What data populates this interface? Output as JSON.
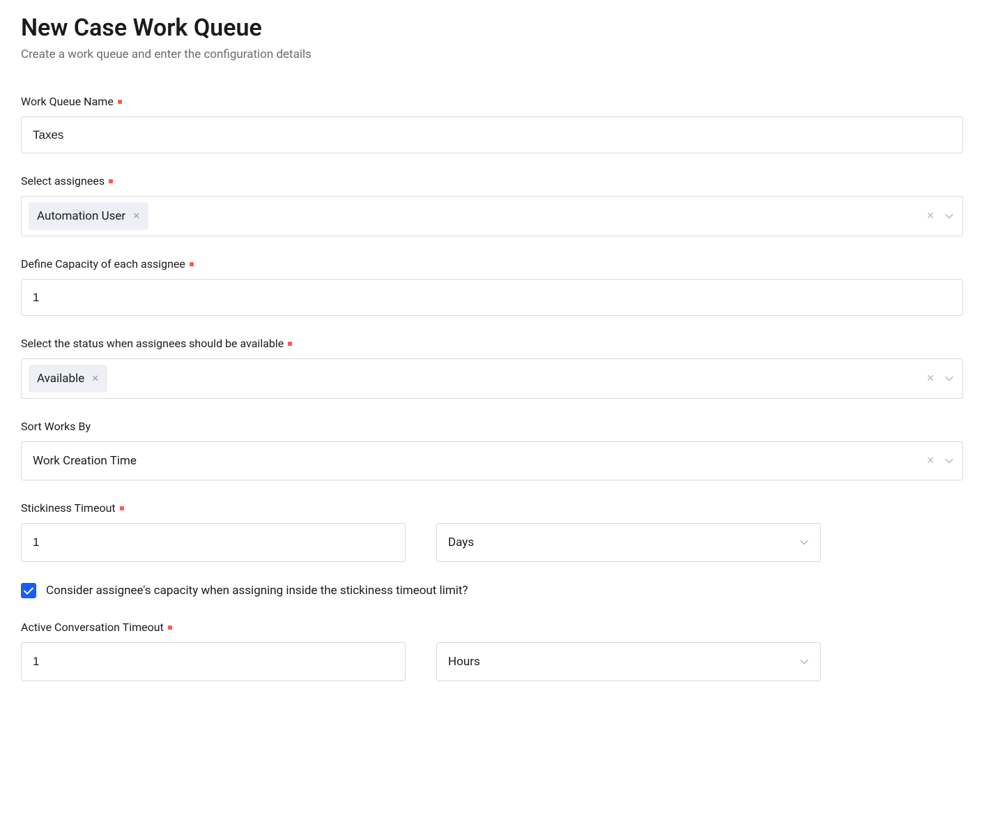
{
  "header": {
    "title": "New Case Work Queue",
    "subtitle": "Create a work queue and enter the configuration details"
  },
  "fields": {
    "work_queue_name": {
      "label": "Work Queue Name",
      "value": "Taxes"
    },
    "select_assignees": {
      "label": "Select assignees",
      "chips": [
        "Automation User"
      ]
    },
    "capacity": {
      "label": "Define Capacity of each assignee",
      "value": "1"
    },
    "status_available": {
      "label": "Select the status when assignees should be available",
      "chips": [
        "Available"
      ]
    },
    "sort_works_by": {
      "label": "Sort Works By",
      "value": "Work Creation Time"
    },
    "stickiness_timeout": {
      "label": "Stickiness Timeout",
      "value": "1",
      "unit": "Days"
    },
    "consider_capacity": {
      "label": "Consider assignee's capacity when assigning inside the stickiness timeout limit?",
      "checked": true
    },
    "active_conversation_timeout": {
      "label": "Active Conversation Timeout",
      "value": "1",
      "unit": "Hours"
    }
  }
}
